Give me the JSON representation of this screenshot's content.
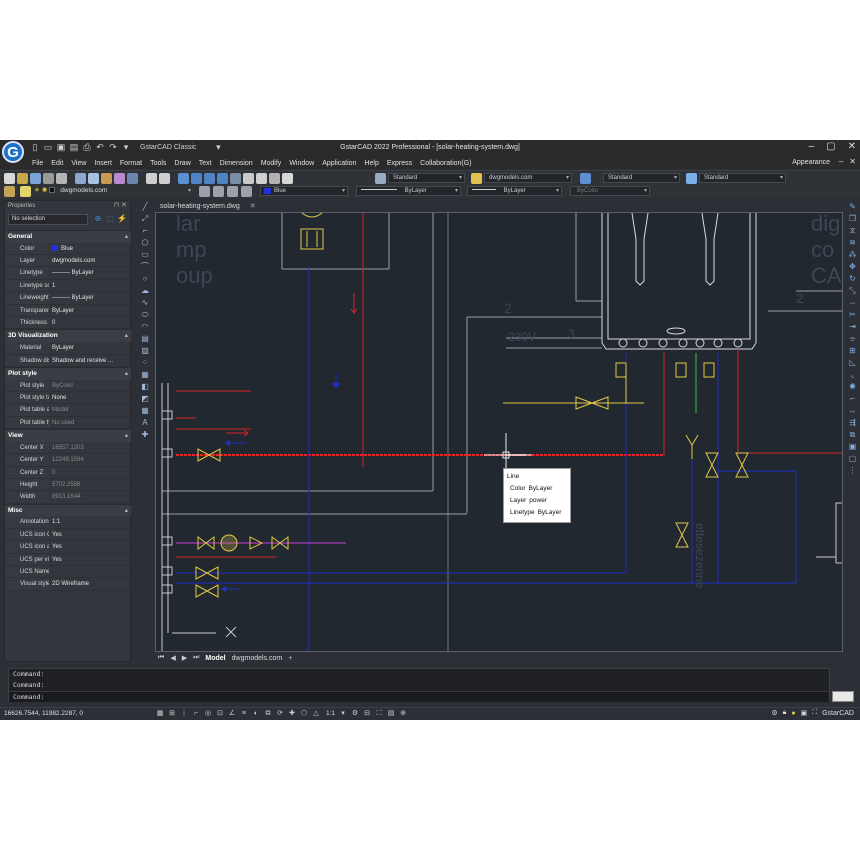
{
  "title_bar": {
    "workspace": "GstarCAD Classic",
    "window_title": "GstarCAD 2022 Professional - [solar-heating-system.dwg]"
  },
  "menu": {
    "items": [
      "File",
      "Edit",
      "View",
      "Insert",
      "Format",
      "Tools",
      "Draw",
      "Text",
      "Dimension",
      "Modify",
      "Window",
      "Application",
      "Help",
      "Express",
      "Collaboration(G)"
    ],
    "appearance": "Appearance"
  },
  "toolbar1": {
    "text_style": "Standard",
    "dim_style": "dwgmodels.com",
    "table_style": "Standard",
    "mleader_style": "Standard"
  },
  "toolbar2": {
    "layer": "dwgmodels.com",
    "color": "Blue",
    "linetype": "ByLayer",
    "lineweight": "ByLayer",
    "plotstyle": "ByColor"
  },
  "properties": {
    "panel_title": "Properties",
    "selection": "No selection",
    "sections": [
      {
        "title": "General",
        "rows": [
          {
            "key": "Color",
            "value": "Blue",
            "swatch": "#2231d8"
          },
          {
            "key": "Layer",
            "value": "dwgmodels.com"
          },
          {
            "key": "Linetype",
            "value": "——— ByLayer"
          },
          {
            "key": "Linetype scale",
            "value": "1"
          },
          {
            "key": "Lineweight",
            "value": "——— ByLayer"
          },
          {
            "key": "Transparency",
            "value": "ByLayer"
          },
          {
            "key": "Thickness",
            "value": "0"
          }
        ]
      },
      {
        "title": "3D Visualization",
        "rows": [
          {
            "key": "Material",
            "value": "ByLayer"
          },
          {
            "key": "Shadow disp...",
            "value": "Shadow and receive ..."
          }
        ]
      },
      {
        "title": "Plot style",
        "rows": [
          {
            "key": "Plot style",
            "value": "ByColor",
            "dim": true
          },
          {
            "key": "Plot style table",
            "value": "None"
          },
          {
            "key": "Plot table att...",
            "value": "Model",
            "dim": true
          },
          {
            "key": "Plot table type",
            "value": "No used",
            "dim": true
          }
        ]
      },
      {
        "title": "View",
        "rows": [
          {
            "key": "Center X",
            "value": "16557.1203",
            "dim": true
          },
          {
            "key": "Center Y",
            "value": "12249.1594",
            "dim": true
          },
          {
            "key": "Center Z",
            "value": "0",
            "dim": true
          },
          {
            "key": "Height",
            "value": "5702.2588",
            "dim": true
          },
          {
            "key": "Width",
            "value": "8913.1644",
            "dim": true
          }
        ]
      },
      {
        "title": "Misc",
        "rows": [
          {
            "key": "Annotation s...",
            "value": "1:1"
          },
          {
            "key": "UCS icon On",
            "value": "Yes"
          },
          {
            "key": "UCS icon at ...",
            "value": "Yes"
          },
          {
            "key": "UCS per vie...",
            "value": "Yes"
          },
          {
            "key": "UCS Name",
            "value": ""
          },
          {
            "key": "Visual styles",
            "value": "2D Wireframe"
          }
        ]
      }
    ]
  },
  "document_tab": "solar-heating-system.dwg",
  "layout_tabs": [
    "Model",
    "dwgmodels.com"
  ],
  "tooltip": {
    "type": "Line",
    "color_label": "Color",
    "color_value": "ByLayer",
    "layer_label": "Layer",
    "layer_value": "power",
    "linetype_label": "Linetype",
    "linetype_value": "ByLayer"
  },
  "drawing_text": {
    "left_fragment_1": "lar",
    "left_fragment_2": "mp",
    "left_fragment_3": "oup",
    "right_fragment_1": "dig",
    "right_fragment_2": "co",
    "right_fragment_3": "CA",
    "num_2a": "2",
    "num_2b": "2",
    "num_3": "3",
    "label_230": "230V",
    "label_vertical": "ettesezenne"
  },
  "command": {
    "lines": [
      "Command:",
      "Command:"
    ],
    "prompt": "Command:"
  },
  "status": {
    "coords": "16626.7544, 11982.2287, 0",
    "scale": "1:1",
    "brand": "GstarCAD"
  },
  "colors": {
    "accent": "#1f6fc5",
    "canvas": "#222830",
    "red_line": "#e0262a",
    "blue_line": "#1e2fc6",
    "yellow": "#e8d24a",
    "magenta": "#c43bd6",
    "green": "#2fc43a"
  }
}
